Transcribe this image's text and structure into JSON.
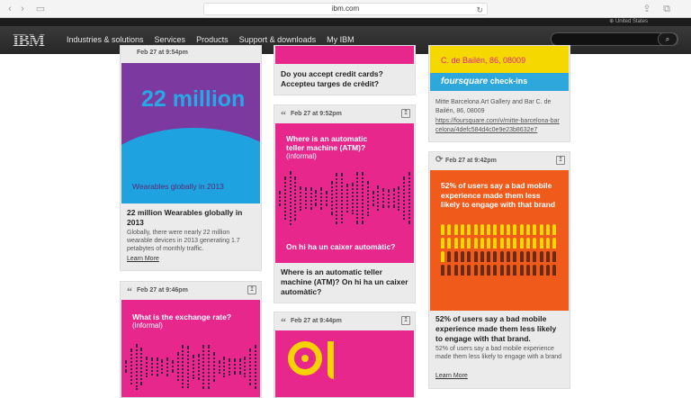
{
  "browser": {
    "url": "ibm.com"
  },
  "masthead": {
    "region": "United States",
    "logo": "IBM",
    "menu": [
      "Industries & solutions",
      "Services",
      "Products",
      "Support & downloads",
      "My IBM"
    ]
  },
  "cards": {
    "wearables": {
      "date": "Feb 27 at 9:54pm",
      "big": "22 million",
      "caption": "Wearables globally in 2013",
      "title": "22 million Wearables globally in 2013",
      "desc": "Globally, there were nearly 22 million wearable devices in 2013 generating 1.7 petabytes of monthly traffic.",
      "more": "Learn More"
    },
    "credit": {
      "title": "Do you accept credit cards? Accepteu targes de crèdit?"
    },
    "atm": {
      "date": "Feb 27 at 9:52pm",
      "q": "Where is an automatic teller machine (ATM)?",
      "informal": "(informal)",
      "answer": "On hi ha un caixer automàtic?",
      "title": "Where is an automatic teller machine (ATM)? On hi ha un caixer automàtic?"
    },
    "foursquare": {
      "addr": "C. de Bailén, 86, 08009",
      "brand": "foursquare",
      "checkins": " check-ins",
      "desc": "Mitte Barcelona Art Gallery and Bar C. de Bailén, 86, 08009",
      "link": "https://foursquare.com/v/mitte-barcelona-barcelona/4defc584d4c0e9e23b8632e7"
    },
    "mobile": {
      "date": "Feb 27 at 9:42pm",
      "headline": "52% of users say a bad mobile experience made them less likely to engage with that brand",
      "title": "52% of users say a bad mobile experience made them less likely to engage with that brand.",
      "desc": "52% of users say a bad mobile experience made them less likely to engage with a brand",
      "more": "Learn More"
    },
    "exchange": {
      "date": "Feb 27 at 9:46pm",
      "q": "What is the exchange rate?",
      "informal": "(informal)"
    },
    "music": {
      "date": "Feb 27 at 9:44pm"
    }
  }
}
